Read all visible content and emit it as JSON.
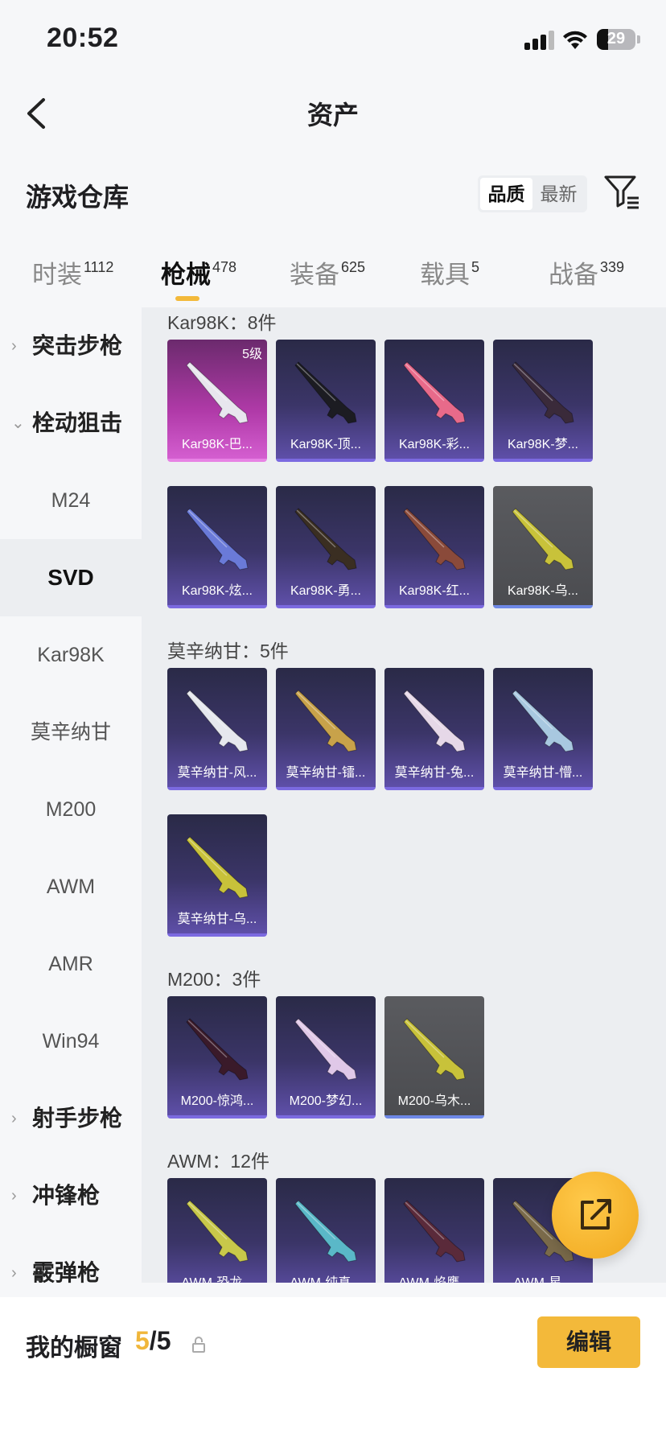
{
  "status": {
    "time": "20:52",
    "battery": "29"
  },
  "header": {
    "title": "资产"
  },
  "warehouse": {
    "title": "游戏仓库",
    "sort_options": [
      "品质",
      "最新"
    ]
  },
  "tabs": [
    {
      "label": "时装",
      "count": "1112"
    },
    {
      "label": "枪械",
      "count": "478"
    },
    {
      "label": "装备",
      "count": "625"
    },
    {
      "label": "载具",
      "count": "5"
    },
    {
      "label": "战备",
      "count": "339"
    }
  ],
  "sidebar": [
    {
      "label": "突击步枪",
      "type": "category"
    },
    {
      "label": "栓动狙击",
      "type": "category",
      "expanded": true
    },
    {
      "label": "M24"
    },
    {
      "label": "SVD",
      "active": true
    },
    {
      "label": "Kar98K"
    },
    {
      "label": "莫辛纳甘"
    },
    {
      "label": "M200"
    },
    {
      "label": "AWM"
    },
    {
      "label": "AMR"
    },
    {
      "label": "Win94"
    },
    {
      "label": "射手步枪",
      "type": "category"
    },
    {
      "label": "冲锋枪",
      "type": "category"
    },
    {
      "label": "霰弹枪",
      "type": "category"
    }
  ],
  "groups": [
    {
      "label": "Kar98K：8件",
      "items": [
        {
          "name": "Kar98K-巴...",
          "level": "5级",
          "style": "pink",
          "gun_color": "#e8e6ee"
        },
        {
          "name": "Kar98K-顶...",
          "style": "purple",
          "gun_color": "#1c1c22"
        },
        {
          "name": "Kar98K-彩...",
          "style": "purple",
          "gun_color": "#e86a8a"
        },
        {
          "name": "Kar98K-梦...",
          "style": "purple",
          "gun_color": "#3a2a3a"
        },
        {
          "name": "Kar98K-炫...",
          "style": "purple",
          "gun_color": "#6a7ad8"
        },
        {
          "name": "Kar98K-勇...",
          "style": "purple",
          "gun_color": "#3a2e22"
        },
        {
          "name": "Kar98K-红...",
          "style": "purple",
          "gun_color": "#8a4a3a"
        },
        {
          "name": "Kar98K-乌...",
          "style": "gray",
          "gun_color": "#c8c23a"
        }
      ]
    },
    {
      "label": "莫辛纳甘：5件",
      "items": [
        {
          "name": "莫辛纳甘-风...",
          "style": "purple",
          "gun_color": "#e6e8ee"
        },
        {
          "name": "莫辛纳甘-镭...",
          "style": "purple",
          "gun_color": "#c8a24a"
        },
        {
          "name": "莫辛纳甘-兔...",
          "style": "purple",
          "gun_color": "#e6d8e8"
        },
        {
          "name": "莫辛纳甘-懵...",
          "style": "purple",
          "gun_color": "#a8c8e0"
        },
        {
          "name": "莫辛纳甘-乌...",
          "style": "purple",
          "gun_color": "#c8c23a"
        }
      ]
    },
    {
      "label": "M200：3件",
      "items": [
        {
          "name": "M200-惊鸿...",
          "style": "purple",
          "gun_color": "#3a1a2a"
        },
        {
          "name": "M200-梦幻...",
          "style": "purple",
          "gun_color": "#e0c8e8"
        },
        {
          "name": "M200-乌木...",
          "style": "gray",
          "gun_color": "#c8c23a"
        }
      ]
    },
    {
      "label": "AWM：12件",
      "items": [
        {
          "name": "AWM-恐龙...",
          "style": "purple",
          "gun_color": "#c8c84a"
        },
        {
          "name": "AWM-纯真...",
          "style": "purple",
          "gun_color": "#5ab8c8"
        },
        {
          "name": "AWM-焰鹰...",
          "style": "purple",
          "gun_color": "#5a2a3a"
        },
        {
          "name": "AWM-星...",
          "style": "purple",
          "gun_color": "#7a6a4a"
        }
      ]
    }
  ],
  "showcase": {
    "label": "我的橱窗",
    "current": "5",
    "total": "/5",
    "edit_label": "编辑"
  },
  "colors": {
    "accent": "#f3b93a",
    "card_purple": "#5e4fa8",
    "card_pink": "#d45ed0",
    "card_gray": "#4b4c50"
  }
}
